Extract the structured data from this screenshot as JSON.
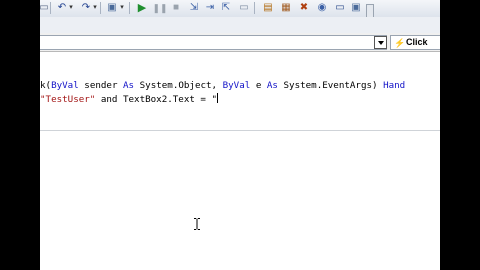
{
  "toolbar": {
    "buttons": [
      {
        "name": "open-folder-icon",
        "glyph": "▭"
      },
      {
        "name": "undo-icon",
        "glyph": "↶"
      },
      {
        "name": "redo-icon",
        "glyph": "↷"
      },
      {
        "name": "debug-target-icon",
        "glyph": "▣"
      },
      {
        "name": "start-icon",
        "glyph": "▶"
      },
      {
        "name": "pause-icon",
        "glyph": "⏸"
      },
      {
        "name": "stop-icon",
        "glyph": "■"
      },
      {
        "name": "step-into-icon",
        "glyph": "⇲"
      },
      {
        "name": "step-over-icon",
        "glyph": "⇥"
      },
      {
        "name": "step-out-icon",
        "glyph": "⇱"
      },
      {
        "name": "solution-explorer-icon",
        "glyph": "▤"
      },
      {
        "name": "properties-icon",
        "glyph": "▦"
      },
      {
        "name": "toolbox-icon",
        "glyph": "✖"
      },
      {
        "name": "object-browser-icon",
        "glyph": "◉"
      },
      {
        "name": "class-view-icon",
        "glyph": "▭"
      }
    ]
  },
  "navigation": {
    "object_combo_value": "",
    "event_combo_value": "Click",
    "event_icon": "lightning-icon"
  },
  "code": {
    "line1": {
      "a": "k(",
      "b": "ByVal",
      "c": " sender ",
      "d": "As",
      "e": " System.Object, ",
      "f": "ByVal",
      "g": " e ",
      "h": "As",
      "i": " System.EventArgs) ",
      "j": "Hand"
    },
    "line2": {
      "a": "\"TestUser\"",
      "b": " and TextBox2.Text = \""
    }
  },
  "colors": {
    "keyword": "#1414c8",
    "string": "#a31515",
    "background": "#000000"
  }
}
